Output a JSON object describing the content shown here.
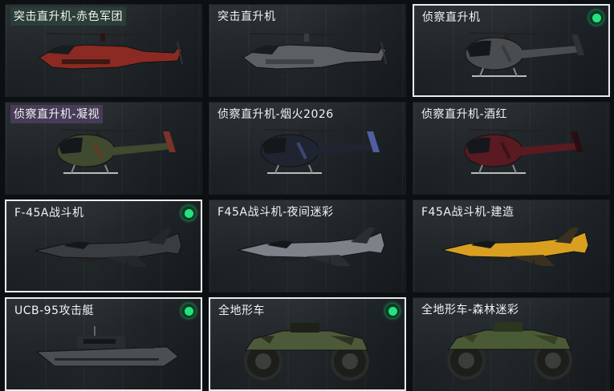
{
  "vehicles": [
    {
      "name": "突击直升机-赤色军团",
      "rarity": "green",
      "equipped": false,
      "selected": false,
      "kind": "heli-attack",
      "colors": {
        "body": "#8a2a22",
        "accent": "#2a1512"
      }
    },
    {
      "name": "突击直升机",
      "rarity": "none",
      "equipped": false,
      "selected": false,
      "kind": "heli-attack",
      "colors": {
        "body": "#5c6064",
        "accent": "#3a3d40"
      }
    },
    {
      "name": "侦察直升机",
      "rarity": "none",
      "equipped": true,
      "selected": true,
      "kind": "heli-scout",
      "colors": {
        "body": "#4a4d50",
        "accent": "#2f3133"
      }
    },
    {
      "name": "侦察直升机-凝视",
      "rarity": "purple",
      "equipped": false,
      "selected": false,
      "kind": "heli-scout",
      "colors": {
        "body": "#3f4a2e",
        "accent": "#7a3328"
      }
    },
    {
      "name": "侦察直升机-烟火2026",
      "rarity": "none",
      "equipped": false,
      "selected": false,
      "kind": "heli-scout",
      "colors": {
        "body": "#1f2430",
        "accent": "#4f5fa0"
      }
    },
    {
      "name": "侦察直升机-酒红",
      "rarity": "none",
      "equipped": false,
      "selected": false,
      "kind": "heli-scout",
      "colors": {
        "body": "#5a1a22",
        "accent": "#2a0d12"
      }
    },
    {
      "name": "F-45A战斗机",
      "rarity": "none",
      "equipped": true,
      "selected": true,
      "kind": "jet",
      "colors": {
        "body": "#3a3d40",
        "accent": "#25282a"
      }
    },
    {
      "name": "F45A战斗机-夜间迷彩",
      "rarity": "none",
      "equipped": false,
      "selected": false,
      "kind": "jet",
      "colors": {
        "body": "#7c8288",
        "accent": "#2a2e33"
      }
    },
    {
      "name": "F45A战斗机-建造",
      "rarity": "none",
      "equipped": false,
      "selected": false,
      "kind": "jet",
      "colors": {
        "body": "#d9a020",
        "accent": "#3a3020"
      }
    },
    {
      "name": "UCB-95攻击艇",
      "rarity": "none",
      "equipped": true,
      "selected": true,
      "kind": "boat",
      "colors": {
        "body": "#4a4f54",
        "accent": "#2a2d30"
      }
    },
    {
      "name": "全地形车",
      "rarity": "none",
      "equipped": true,
      "selected": true,
      "kind": "atv",
      "colors": {
        "body": "#4d5a3a",
        "accent": "#1e2118"
      }
    },
    {
      "name": "全地形车-森林迷彩",
      "rarity": "none",
      "equipped": false,
      "selected": false,
      "kind": "atv",
      "colors": {
        "body": "#4a5a34",
        "accent": "#2c3520"
      }
    }
  ]
}
